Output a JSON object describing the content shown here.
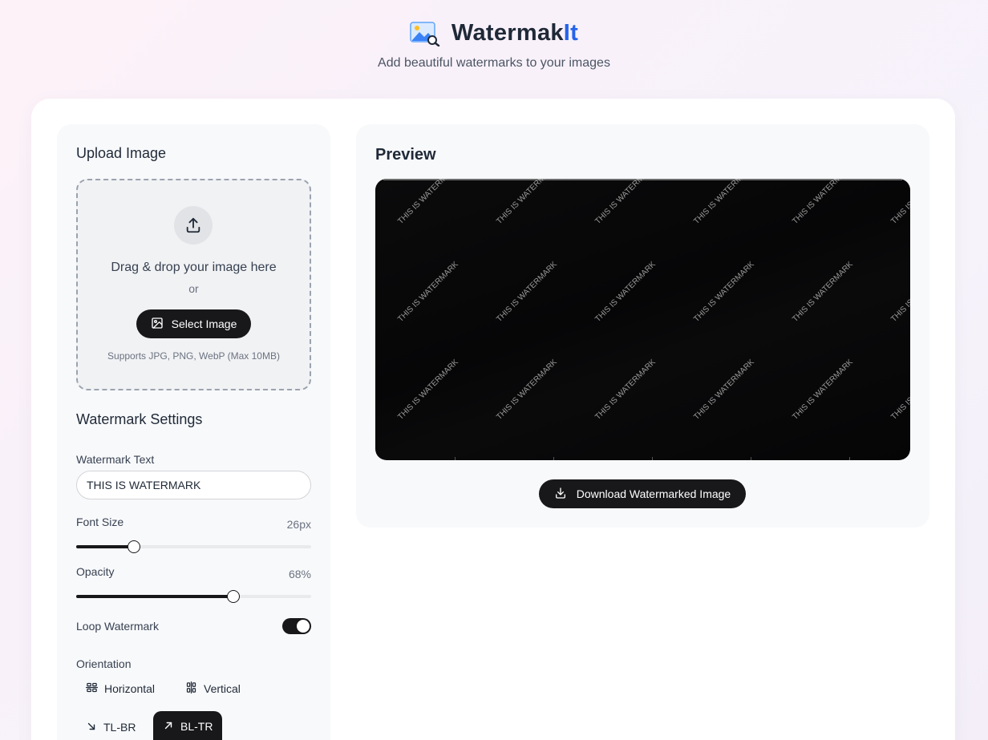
{
  "app": {
    "title_main": "Watermak",
    "title_accent": "It",
    "subtitle": "Add beautiful watermarks to your images",
    "logo_icon": "image-search-icon",
    "accent_color": "#2563eb"
  },
  "upload": {
    "title": "Upload Image",
    "drop_text": "Drag & drop your image here",
    "or_text": "or",
    "select_label": "Select Image",
    "support_text": "Supports JPG, PNG, WebP (Max 10MB)"
  },
  "settings": {
    "title": "Watermark Settings",
    "text_label": "Watermark Text",
    "text_value": "THIS IS WATERMARK",
    "font_size_label": "Font Size",
    "font_size_display": "26px",
    "font_size_fraction": 0.245,
    "opacity_label": "Opacity",
    "opacity_display": "68%",
    "opacity_fraction": 0.67,
    "loop_label": "Loop Watermark",
    "loop_enabled": true,
    "orientation_label": "Orientation",
    "orientations": [
      {
        "label": "Horizontal",
        "icon": "horizontal-icon",
        "active": false
      },
      {
        "label": "Vertical",
        "icon": "vertical-icon",
        "active": false
      },
      {
        "label": "TL-BR",
        "icon": "arrow-down-right-icon",
        "active": false
      },
      {
        "label": "BL-TR",
        "icon": "arrow-up-right-icon",
        "active": true
      }
    ]
  },
  "preview": {
    "title": "Preview",
    "watermark_text": "THIS IS WATERMARK",
    "download_label": "Download Watermarked Image"
  }
}
